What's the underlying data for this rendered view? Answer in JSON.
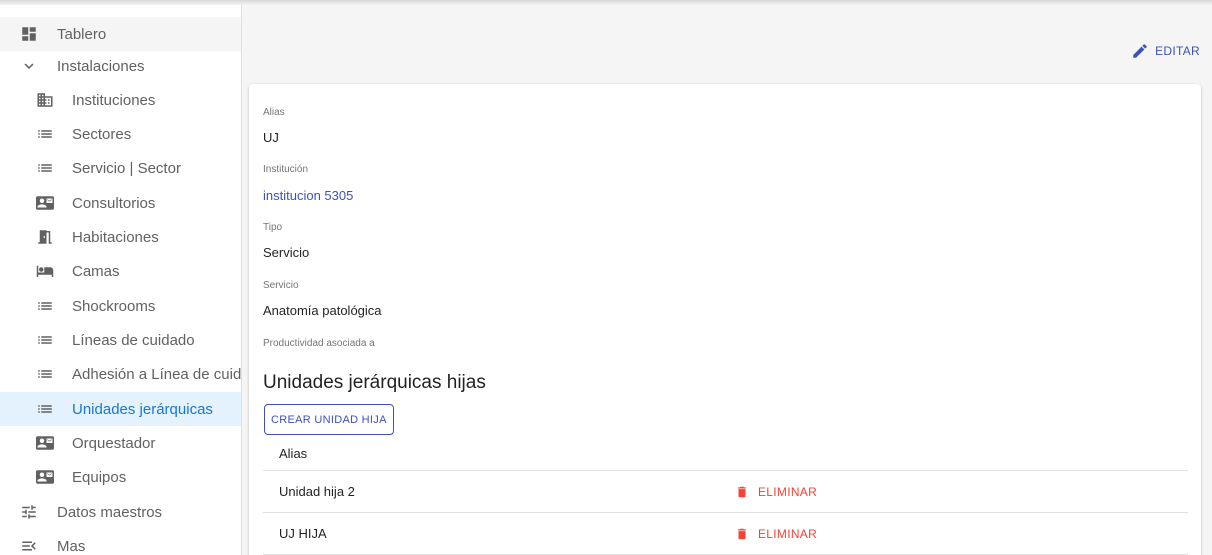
{
  "colors": {
    "accent": "#3f51b5",
    "active_nav": "#1976d2",
    "active_nav_bg": "#e3f2fd",
    "danger": "#f44336"
  },
  "sidebar": {
    "items": [
      {
        "label": "Tablero",
        "icon": "dashboard-icon"
      },
      {
        "label": "Instalaciones",
        "icon": "chevron-down-icon"
      },
      {
        "label": "Instituciones",
        "icon": "domain-icon"
      },
      {
        "label": "Sectores",
        "icon": "list-icon"
      },
      {
        "label": "Servicio | Sector",
        "icon": "list-icon"
      },
      {
        "label": "Consultorios",
        "icon": "contact-mail-icon"
      },
      {
        "label": "Habitaciones",
        "icon": "door-icon"
      },
      {
        "label": "Camas",
        "icon": "bed-icon"
      },
      {
        "label": "Shockrooms",
        "icon": "list-icon"
      },
      {
        "label": "Líneas de cuidado",
        "icon": "list-icon"
      },
      {
        "label": "Adhesión a Línea de cuidado",
        "icon": "list-icon"
      },
      {
        "label": "Unidades jerárquicas",
        "icon": "list-icon"
      },
      {
        "label": "Orquestador",
        "icon": "contact-mail-icon"
      },
      {
        "label": "Equipos",
        "icon": "contact-mail-icon"
      },
      {
        "label": "Datos maestros",
        "icon": "tune-icon"
      },
      {
        "label": "Mas",
        "icon": "menu-open-icon"
      }
    ]
  },
  "main": {
    "edit_label": "EDITAR",
    "fields": [
      {
        "label": "Alias",
        "value": "UJ"
      },
      {
        "label": "Institución",
        "value": "institucion 5305"
      },
      {
        "label": "Tipo",
        "value": "Servicio"
      },
      {
        "label": "Servicio",
        "value": "Anatomía patológica"
      },
      {
        "label": "Productividad asociada a",
        "value": ""
      }
    ],
    "section_title": "Unidades jerárquicas hijas",
    "create_label": "CREAR UNIDAD HIJA",
    "table": {
      "header": "Alias",
      "rows": [
        {
          "alias": "Unidad hija 2",
          "action": "ELIMINAR"
        },
        {
          "alias": "UJ HIJA",
          "action": "ELIMINAR"
        }
      ]
    }
  }
}
